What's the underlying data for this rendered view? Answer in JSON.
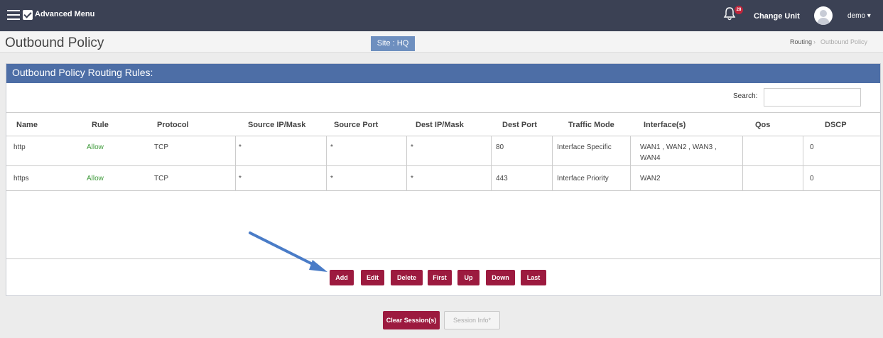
{
  "topbar": {
    "advanced_menu_label": "Advanced Menu",
    "notification_count": "28",
    "change_unit_label": "Change Unit",
    "user_label": "demo ▾"
  },
  "header": {
    "title": "Outbound Policy",
    "site_label": "Site : HQ",
    "breadcrumb": {
      "parent": "Routing",
      "separator": "›",
      "current": "Outbound Policy"
    }
  },
  "panel": {
    "title": "Outbound Policy Routing Rules:",
    "search_label": "Search:",
    "search_value": ""
  },
  "table": {
    "columns": [
      "Name",
      "Rule",
      "Protocol",
      "Source IP/Mask",
      "Source Port",
      "Dest IP/Mask",
      "Dest Port",
      "Traffic Mode",
      "Interface(s)",
      "Qos",
      "DSCP"
    ],
    "rows": [
      {
        "name": "http",
        "rule": "Allow",
        "protocol": "TCP",
        "source_ip": "*",
        "source_port": "*",
        "dest_ip": "*",
        "dest_port": "80",
        "traffic_mode": "Interface Specific",
        "interfaces_line1": "WAN1 , WAN2 , WAN3 ,",
        "interfaces_line2": "WAN4",
        "qos": "",
        "dscp": "0"
      },
      {
        "name": "https",
        "rule": "Allow",
        "protocol": "TCP",
        "source_ip": "*",
        "source_port": "*",
        "dest_ip": "*",
        "dest_port": "443",
        "traffic_mode": "Interface Priority",
        "interfaces_line1": "WAN2",
        "interfaces_line2": "",
        "qos": "",
        "dscp": "0"
      }
    ]
  },
  "actions": {
    "add": "Add",
    "edit": "Edit",
    "delete": "Delete",
    "first": "First",
    "up": "Up",
    "down": "Down",
    "last": "Last"
  },
  "footer": {
    "clear_sessions": "Clear Session(s)",
    "session_info": "Session Info*"
  },
  "colors": {
    "topbar": "#3b4154",
    "panel_header": "#4d6ea6",
    "button": "#9c1a3f",
    "allow_text": "#3e9a3a",
    "annotation_arrow": "#4a7cc7"
  },
  "icons": [
    "hamburger-icon",
    "checkbox-icon",
    "bell-icon",
    "user-avatar-icon",
    "annotation-arrow"
  ]
}
